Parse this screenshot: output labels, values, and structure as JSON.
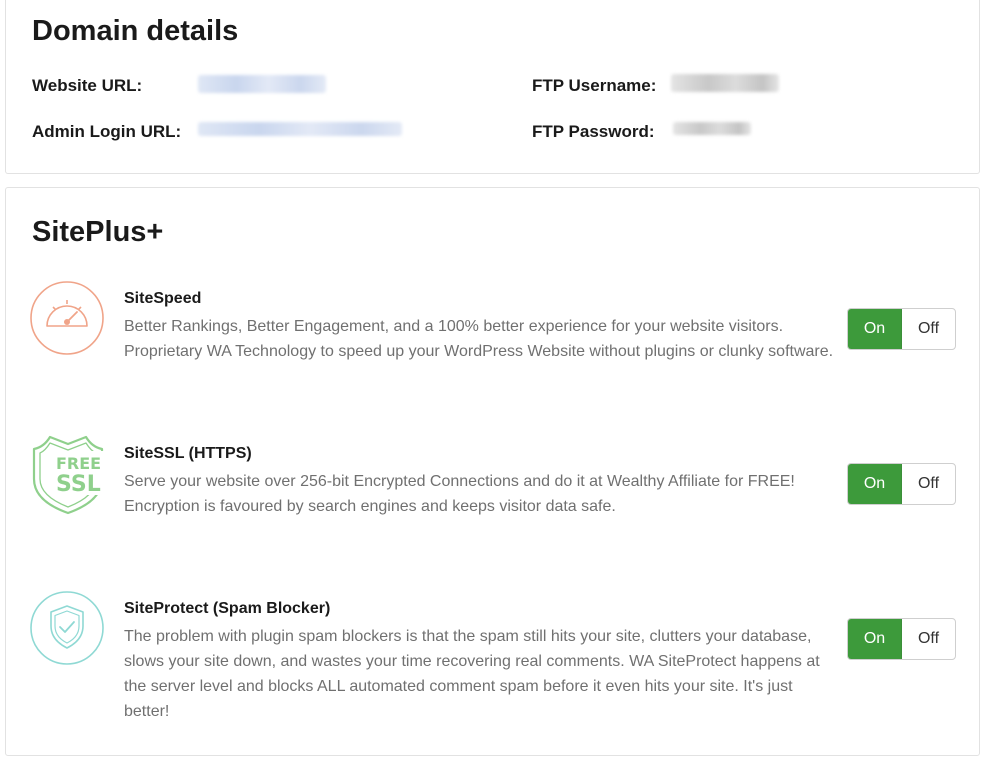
{
  "domain": {
    "title": "Domain details",
    "fields": [
      {
        "label": "Website URL:"
      },
      {
        "label": "Admin Login URL:"
      },
      {
        "label": "FTP Username:"
      },
      {
        "label": "FTP Password:"
      }
    ]
  },
  "siteplus": {
    "title": "SitePlus+",
    "features": [
      {
        "title": "SiteSpeed",
        "description": "Better Rankings, Better Engagement, and a 100% better experience for your website visitors. Proprietary WA Technology to speed up your WordPress Website without plugins or clunky software.",
        "icon": "speedometer-icon",
        "on_label": "On",
        "off_label": "Off",
        "state": "on"
      },
      {
        "title": "SiteSSL (HTTPS)",
        "description": "Serve your website over 256-bit Encrypted Connections and do it at Wealthy Affiliate for FREE! Encryption is favoured by search engines and keeps visitor data safe.",
        "icon": "free-ssl-shield-icon",
        "icon_text_top": "FREE",
        "icon_text_bottom": "SSL",
        "on_label": "On",
        "off_label": "Off",
        "state": "on"
      },
      {
        "title": "SiteProtect (Spam Blocker)",
        "description": "The problem with plugin spam blockers is that the spam still hits your site, clutters your database, slows your site down, and wastes your time recovering real comments. WA SiteProtect happens at the server level and blocks ALL automated comment spam before it even hits your site. It's just better!",
        "icon": "shield-check-icon",
        "on_label": "On",
        "off_label": "Off",
        "state": "on"
      }
    ]
  },
  "colors": {
    "toggle_on": "#3d9a3b",
    "speed_icon": "#f0a489",
    "ssl_icon": "#8fd08c",
    "protect_icon": "#8fd9d4"
  }
}
